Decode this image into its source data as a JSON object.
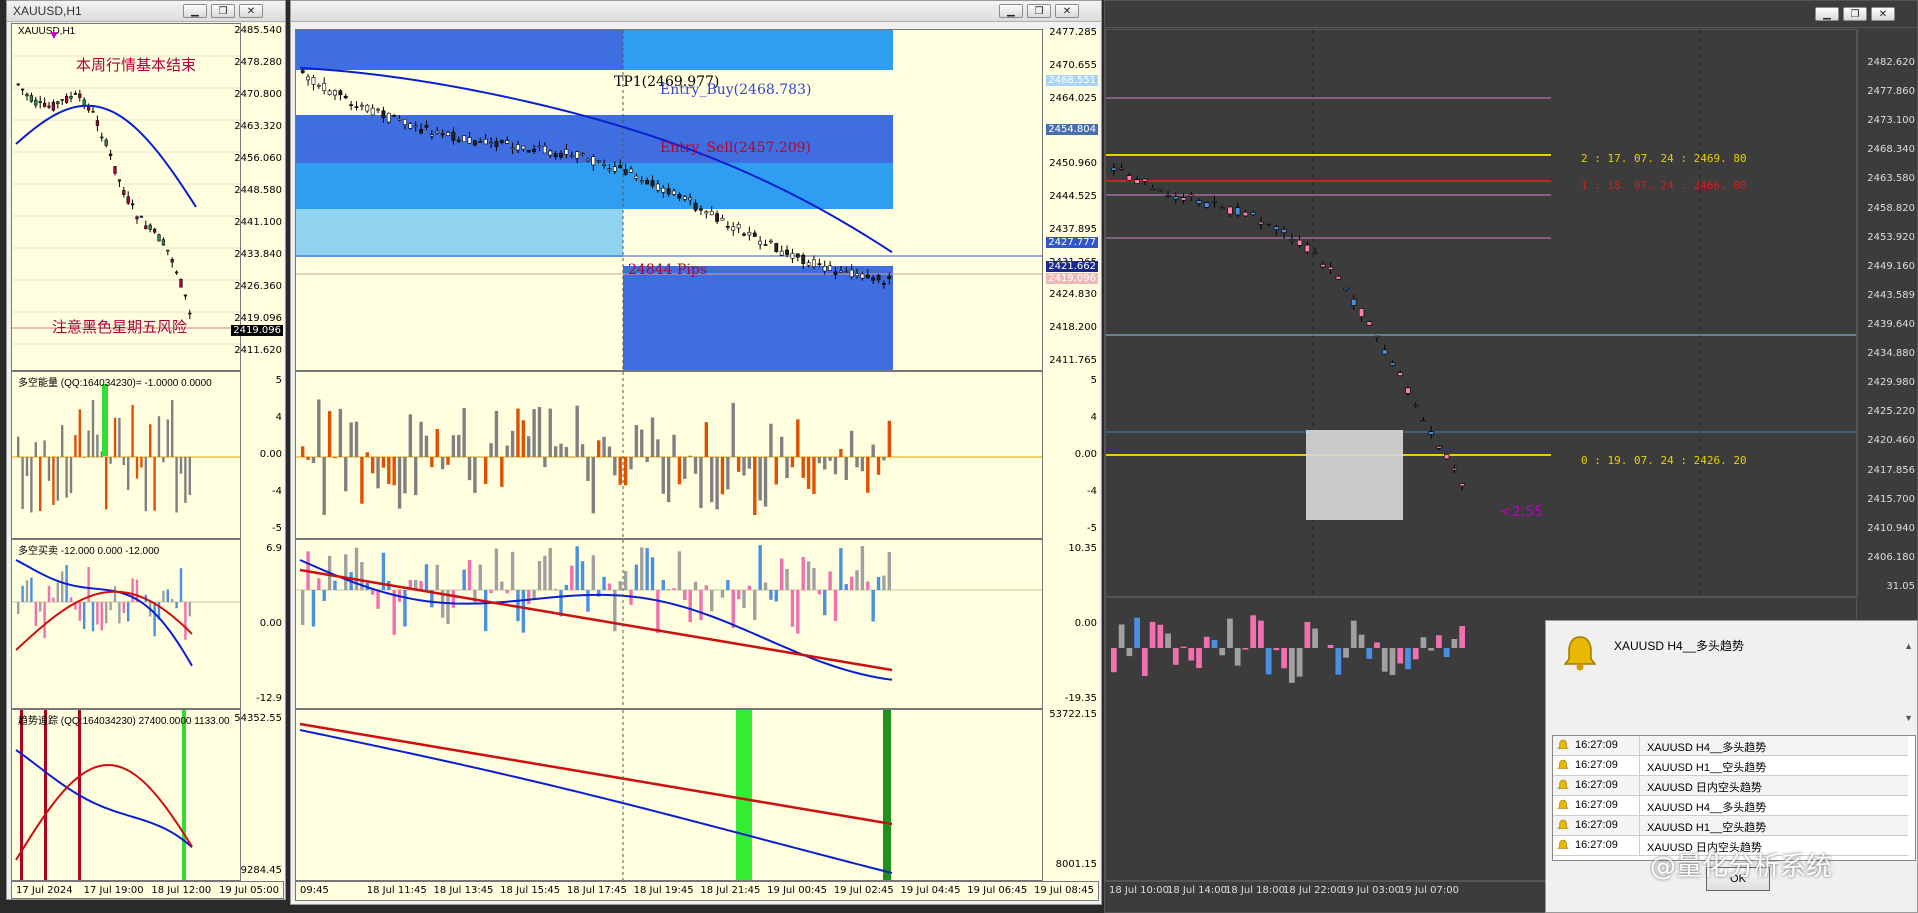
{
  "win1": {
    "title": "XAUUSD,H1",
    "main": {
      "symbol_label": "XAUUSD,H1",
      "note_top": "本周行情基本结束",
      "note_bottom": "注意黑色星期五风险",
      "ticks": [
        "2485.540",
        "2478.280",
        "2470.800",
        "2463.320",
        "2456.060",
        "2448.580",
        "2441.100",
        "2433.840",
        "2426.360",
        "2419.096",
        "2411.620"
      ],
      "price_tag": "2419.096"
    },
    "ind1": {
      "label": "多空能量 (QQ:164034230)= -1.0000 0.0000",
      "ticks": [
        "5",
        "4",
        "0.00",
        "-4",
        "-5"
      ]
    },
    "ind2": {
      "label": "多空买卖 -12.000 0.000 -12.000",
      "ticks": [
        "6.9",
        "0.00",
        "-12.9"
      ]
    },
    "ind3": {
      "label": "趋势追踪 (QQ:164034230) 27400.0000 1133.00",
      "ticks": [
        "54352.55",
        "9284.45"
      ]
    },
    "time_labels": [
      "17 Jul 2024",
      "17 Jul 19:00",
      "18 Jul 12:00",
      "19 Jul 05:00"
    ]
  },
  "win2": {
    "main": {
      "tp_label": "TP1(2469.977)",
      "entry_buy": "Entry_Buy(2468.783)",
      "entry_sell": "Entry_Sell(2457.209)",
      "pips": "24844 Pips",
      "ticks": [
        "2477.285",
        "2470.655",
        "2464.025",
        "2457.590",
        "2450.960",
        "2444.525",
        "2437.895",
        "2431.265",
        "2424.830",
        "2418.200",
        "2411.765"
      ],
      "tags": [
        {
          "text": "2468.551",
          "color": "#a9d4f5"
        },
        {
          "text": "2454.804",
          "color": "#4a6fb0"
        },
        {
          "text": "2427.777",
          "color": "#3355cc"
        },
        {
          "text": "2421.662",
          "color": "#1a2a8a"
        },
        {
          "text": "2419.096",
          "color": "#f0b8b8"
        }
      ]
    },
    "ind1": {
      "ticks": [
        "5",
        "4",
        "0.00",
        "-4",
        "-5"
      ]
    },
    "ind2": {
      "ticks": [
        "10.35",
        "0.00",
        "-19.35"
      ]
    },
    "ind3": {
      "ticks": [
        "53722.15",
        "8001.15"
      ]
    },
    "time_labels": [
      "09:45",
      "18 Jul 11:45",
      "18 Jul 13:45",
      "18 Jul 15:45",
      "18 Jul 17:45",
      "18 Jul 19:45",
      "18 Jul 21:45",
      "19 Jul 00:45",
      "19 Jul 02:45",
      "19 Jul 04:45",
      "19 Jul 06:45",
      "19 Jul 08:45"
    ]
  },
  "win3": {
    "ticks": [
      "2482.620",
      "2477.860",
      "2473.100",
      "2468.340",
      "2463.580",
      "2458.820",
      "2453.920",
      "2449.160",
      "2443.589",
      "2439.640",
      "2434.880",
      "2429.980",
      "2425.220",
      "2420.460",
      "2417.856",
      "2415.700",
      "2410.940",
      "2406.180",
      "31.05"
    ],
    "levels": [
      {
        "text": "2 : 17. 07. 24 : 2469. 80",
        "color": "#e8d000"
      },
      {
        "text": "1 : 18. 07. 24 : 2466. 00",
        "color": "#d02020"
      },
      {
        "text": "0 : 19. 07. 24 : 2426. 20",
        "color": "#e8d000"
      }
    ],
    "countdown": "<2:55",
    "time_labels": [
      "18 Jul 10:00",
      "18 Jul 14:00",
      "18 Jul 18:00",
      "18 Jul 22:00",
      "19 Jul 03:00",
      "19 Jul 07:00"
    ]
  },
  "alert": {
    "header_msg": "XAUUSD  H4__多头趋势",
    "rows": [
      {
        "time": "16:27:09",
        "msg": "XAUUSD  H4__多头趋势"
      },
      {
        "time": "16:27:09",
        "msg": "XAUUSD  H1__空头趋势"
      },
      {
        "time": "16:27:09",
        "msg": "XAUUSD  日内空头趋势"
      },
      {
        "time": "16:27:09",
        "msg": "XAUUSD  H4__多头趋势"
      },
      {
        "time": "16:27:09",
        "msg": "XAUUSD  H1__空头趋势"
      },
      {
        "time": "16:27:09",
        "msg": "XAUUSD  日内空头趋势"
      }
    ],
    "ok_label": "OK"
  },
  "watermark": "@量化分析系统",
  "colors": {
    "up_candle": "#2e8b57",
    "down_candle": "#b0003a",
    "ma_blue": "#0a1fd0",
    "ma_red": "#cc1010",
    "zone_blue": "#3f6ee0",
    "zone_light": "#2f9df0",
    "zone_pale": "#8fd3ef"
  }
}
